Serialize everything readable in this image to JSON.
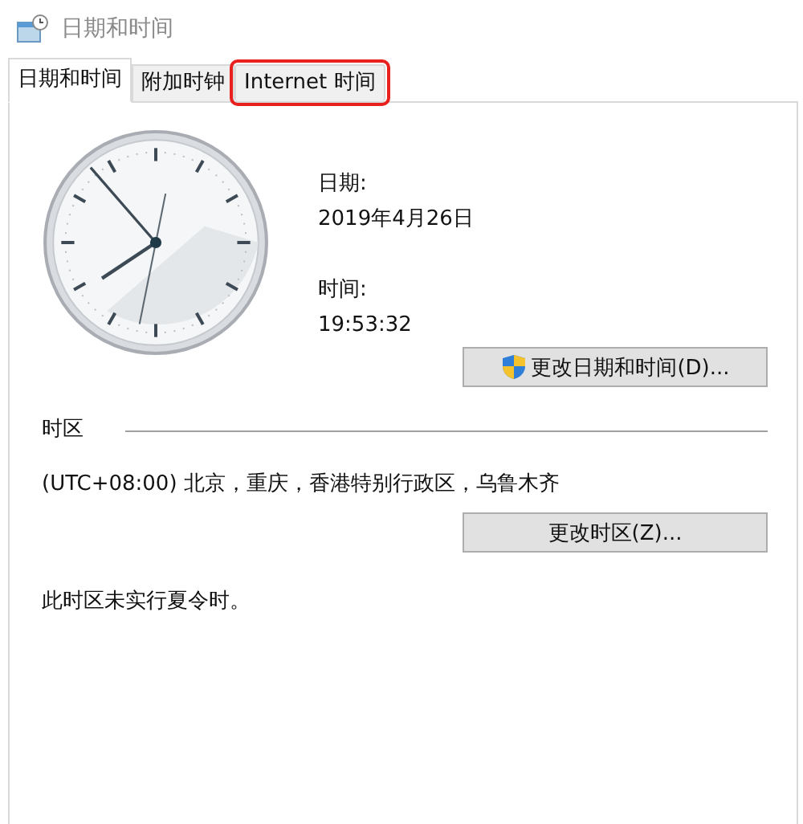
{
  "window": {
    "title": "日期和时间"
  },
  "tabs": [
    {
      "label": "日期和时间",
      "selected": true,
      "highlighted": false
    },
    {
      "label": "附加时钟",
      "selected": false,
      "highlighted": false
    },
    {
      "label": "Internet 时间",
      "selected": false,
      "highlighted": true
    }
  ],
  "date": {
    "label": "日期:",
    "value": "2019年4月26日"
  },
  "time": {
    "label": "时间:",
    "value": "19:53:32"
  },
  "change_datetime_button": {
    "label": "更改日期和时间(D)..."
  },
  "timezone": {
    "heading": "时区",
    "value": "(UTC+08:00) 北京，重庆，香港特别行政区，乌鲁木齐",
    "button": "更改时区(Z)...",
    "note": "此时区未实行夏令时。"
  }
}
